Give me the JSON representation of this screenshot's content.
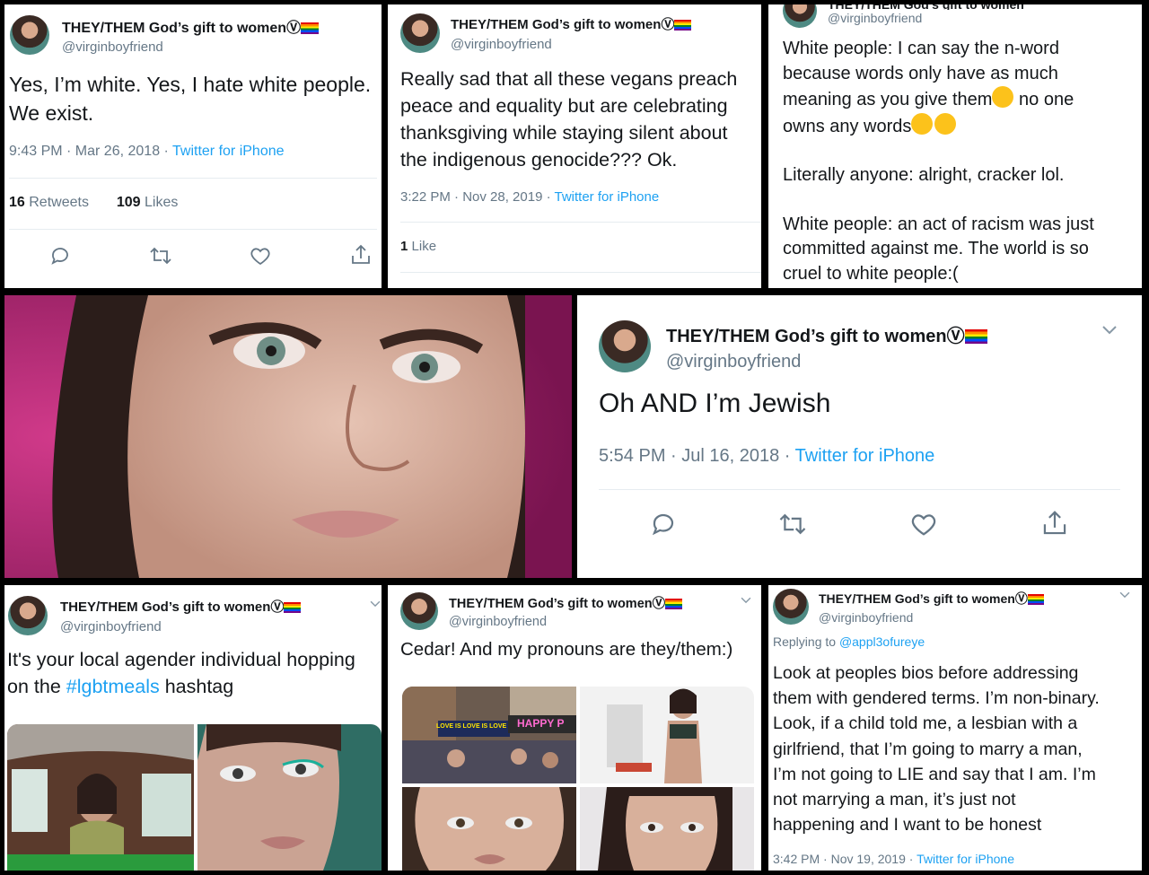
{
  "profile": {
    "name": "THEY/THEM God’s gift to women",
    "name_symbol": "Ⓥ",
    "handle": "@virginboyfriend",
    "rainbow": [
      "#e40303",
      "#ff8c00",
      "#ffed00",
      "#008026",
      "#004dff",
      "#750787"
    ]
  },
  "tweet1": {
    "lines": [
      "Yes, I’m white. Yes, I hate white people.",
      "We exist."
    ],
    "time": "9:43 PM · Mar 26, 2018 · ",
    "source": "Twitter for iPhone",
    "retweets": "16",
    "retweets_label": "Retweets",
    "likes": "109",
    "likes_label": "Likes"
  },
  "tweet2": {
    "lines": [
      "Really sad that all these vegans preach",
      "peace and equality but are celebrating",
      "thanksgiving while staying silent about",
      "the indigenous genocide??? Ok."
    ],
    "time": "3:22 PM · Nov 28, 2019 · ",
    "source": "Twitter for iPhone",
    "likes": "1",
    "likes_label": "Like"
  },
  "tweet3": {
    "l1": "White people: I can say the n-word",
    "l2": "because words only have as much",
    "l3a": "meaning as you give them",
    "l3b": " no one",
    "l4": "owns any words",
    "l5": "Literally anyone: alright, cracker lol.",
    "l6": "White people: an act of racism was just",
    "l7": "committed against me. The world is so",
    "l8": "cruel to white people:("
  },
  "tweet4": {
    "text": "Oh AND I’m Jewish",
    "time": "5:54 PM · Jul 16, 2018 · ",
    "source": "Twitter for iPhone"
  },
  "tweet5": {
    "l1": "It's your local agender individual hopping",
    "l2_pre": "on the ",
    "hashtag": "#lgbtmeals",
    "l2_post": " hashtag"
  },
  "tweet6": {
    "text": "Cedar! And my pronouns are they/them:)",
    "sign_text": "LOVE IS LOVE IS LOVE",
    "banner_text": "HAPPY P"
  },
  "tweet7": {
    "replying_label": "Replying to ",
    "replying_handle": "@appl3ofureye",
    "lines": [
      "Look at peoples bios before addressing",
      "them with gendered terms. I’m non-binary.",
      "Look, if a child told me, a lesbian with a",
      "girlfriend, that I’m going to marry a man,",
      "I’m not going to LIE and say that I am. I’m",
      "not marrying a man, it’s just not",
      "happening and I want to be honest"
    ],
    "time": "3:42 PM · Nov 19, 2019 · ",
    "source": "Twitter for iPhone"
  },
  "icons": {
    "reply": "reply-icon",
    "retweet": "retweet-icon",
    "like": "heart-icon",
    "share": "share-icon",
    "more": "chevron-down-icon"
  }
}
